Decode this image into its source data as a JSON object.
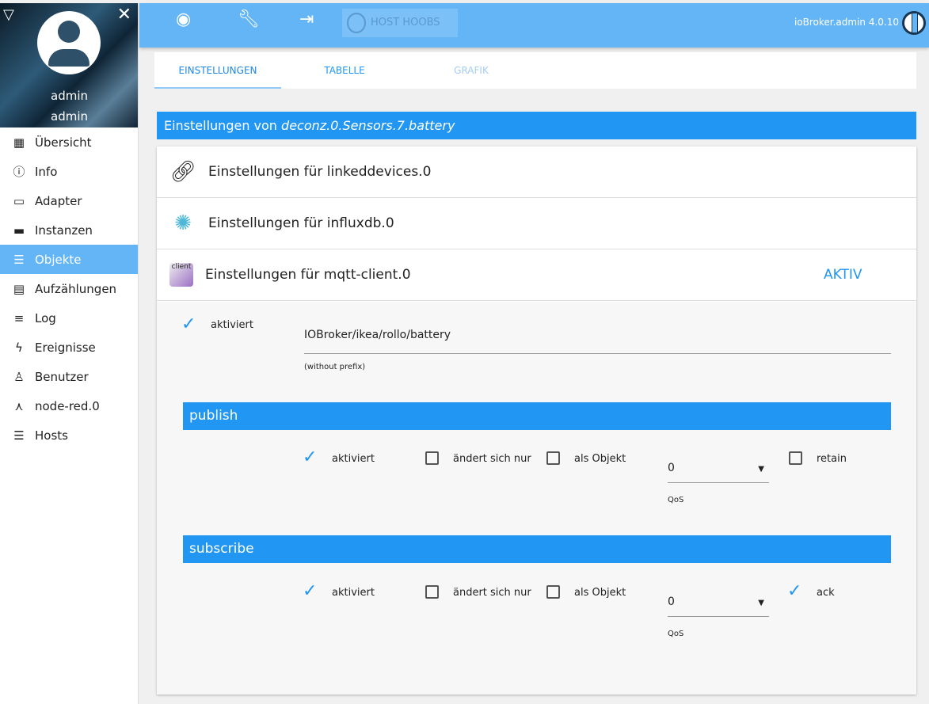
{
  "sidebar": {
    "user": "admin",
    "group": "admin",
    "items": [
      {
        "label": "Übersicht",
        "icon": "apps-icon"
      },
      {
        "label": "Info",
        "icon": "info-icon"
      },
      {
        "label": "Adapter",
        "icon": "store-icon"
      },
      {
        "label": "Instanzen",
        "icon": "instances-icon"
      },
      {
        "label": "Objekte",
        "icon": "list-icon"
      },
      {
        "label": "Aufzählungen",
        "icon": "enum-icon"
      },
      {
        "label": "Log",
        "icon": "log-icon"
      },
      {
        "label": "Ereignisse",
        "icon": "flash-icon"
      },
      {
        "label": "Benutzer",
        "icon": "user-icon"
      },
      {
        "label": "node-red.0",
        "icon": "node-icon"
      },
      {
        "label": "Hosts",
        "icon": "hosts-icon"
      }
    ]
  },
  "header": {
    "host": "HOST HOOBS",
    "version": "ioBroker.admin 4.0.10"
  },
  "tabs": [
    "EINSTELLUNGEN",
    "TABELLE",
    "GRAFIK"
  ],
  "title": {
    "prefix": "Einstellungen von ",
    "object": "deconz.0.Sensors.7.battery"
  },
  "adapters": [
    {
      "label": "Einstellungen für linkeddevices.0"
    },
    {
      "label": "Einstellungen für influxdb.0"
    },
    {
      "label": "Einstellungen für mqtt-client.0",
      "status": "AKTIV",
      "logo_text": "client"
    }
  ],
  "mqtt": {
    "enabled_label": "aktiviert",
    "topic": "IOBroker/ikea/rollo/battery",
    "topic_hint": "(without prefix)",
    "publish": {
      "title": "publish",
      "enabled": "aktiviert",
      "changes_only": "ändert sich nur",
      "as_object": "als Objekt",
      "qos": "0",
      "qos_label": "QoS",
      "retain": "retain"
    },
    "subscribe": {
      "title": "subscribe",
      "enabled": "aktiviert",
      "changes_only": "ändert sich nur",
      "as_object": "als Objekt",
      "qos": "0",
      "qos_label": "QoS",
      "ack": "ack"
    }
  }
}
